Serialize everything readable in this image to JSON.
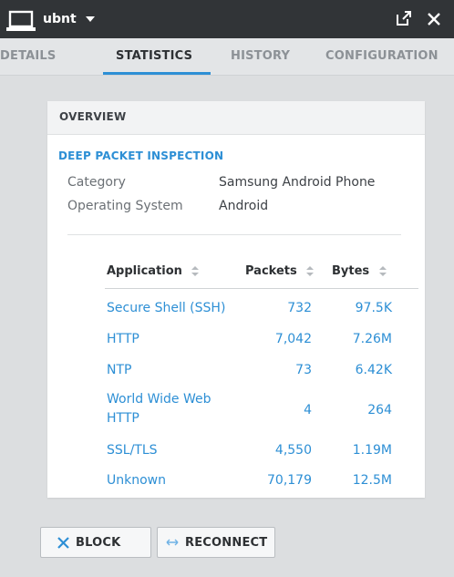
{
  "window": {
    "device_name": "ubnt",
    "icons": {
      "device": "laptop-icon",
      "menu": "caret-down-icon",
      "popout": "popout-icon",
      "close": "close-icon"
    }
  },
  "tabs": [
    {
      "label": "DETAILS",
      "active": false
    },
    {
      "label": "STATISTICS",
      "active": true
    },
    {
      "label": "HISTORY",
      "active": false
    },
    {
      "label": "CONFIGURATION",
      "active": false
    }
  ],
  "overview": {
    "title": "OVERVIEW",
    "dpi_title": "DEEP PACKET INSPECTION",
    "info": [
      {
        "label": "Category",
        "value": "Samsung Android Phone"
      },
      {
        "label": "Operating System",
        "value": "Android"
      }
    ]
  },
  "table": {
    "columns": [
      "Application",
      "Packets",
      "Bytes"
    ],
    "rows": [
      {
        "application": "Secure Shell (SSH)",
        "packets": "732",
        "bytes": "97.5K"
      },
      {
        "application": "HTTP",
        "packets": "7,042",
        "bytes": "7.26M"
      },
      {
        "application": "NTP",
        "packets": "73",
        "bytes": "6.42K"
      },
      {
        "application": "World Wide Web HTTP",
        "packets": "4",
        "bytes": "264"
      },
      {
        "application": "SSL/TLS",
        "packets": "4,550",
        "bytes": "1.19M"
      },
      {
        "application": "Unknown",
        "packets": "70,179",
        "bytes": "12.5M"
      }
    ]
  },
  "actions": {
    "block_label": "BLOCK",
    "reconnect_label": "RECONNECT"
  },
  "colors": {
    "titlebar": "#313437",
    "accent": "#2d8fd5",
    "background": "#dcdee0"
  }
}
